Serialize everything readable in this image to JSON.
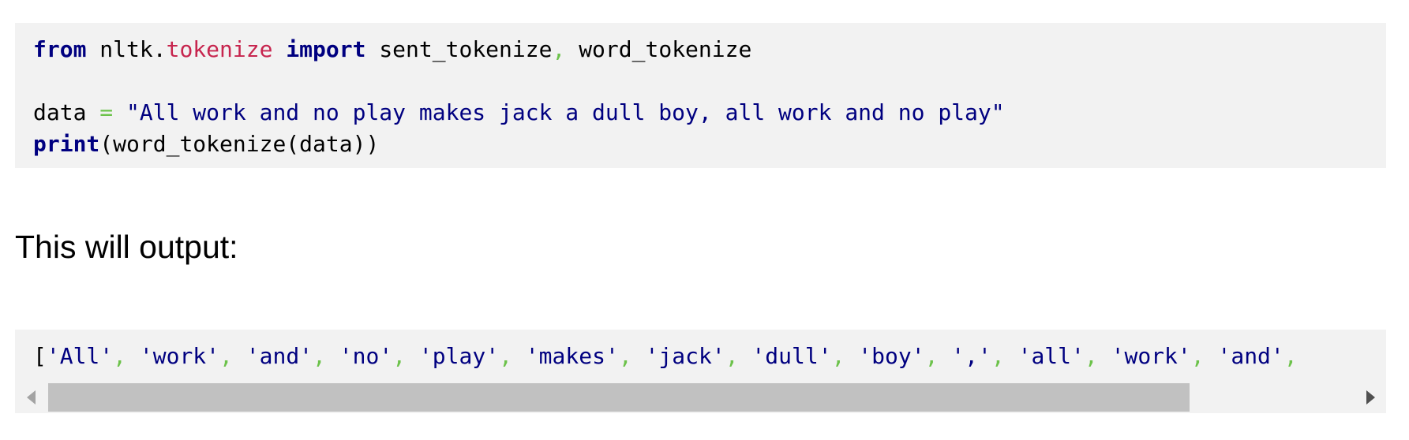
{
  "code_block": {
    "line1": {
      "kw_from": "from",
      "mod_base": " nltk.",
      "mod_sub": "tokenize",
      "kw_import": "import",
      "name1": " sent_tokenize",
      "comma": ",",
      "name2": " word_tokenize"
    },
    "line3": {
      "var": "data ",
      "eq": "=",
      "str": " \"All work and no play makes jack a dull boy, all work and no play\""
    },
    "line4": {
      "kw_print": "print",
      "rest": "(word_tokenize(data))"
    }
  },
  "prose": {
    "text": "This will output:"
  },
  "output": {
    "open": "[",
    "tokens": [
      "'All'",
      "'work'",
      "'and'",
      "'no'",
      "'play'",
      "'makes'",
      "'jack'",
      "'dull'",
      "'boy'",
      "','",
      "'all'",
      "'work'",
      "'and'"
    ],
    "separator": ",",
    "scroll_position": 0.0
  },
  "colors": {
    "keyword": "#000080",
    "module": "#c7254e",
    "operator": "#6cc24a",
    "string": "#000080",
    "code_background": "#f2f2f2"
  },
  "icons": {
    "scroll_left": "triangle-left",
    "scroll_right": "triangle-right"
  }
}
